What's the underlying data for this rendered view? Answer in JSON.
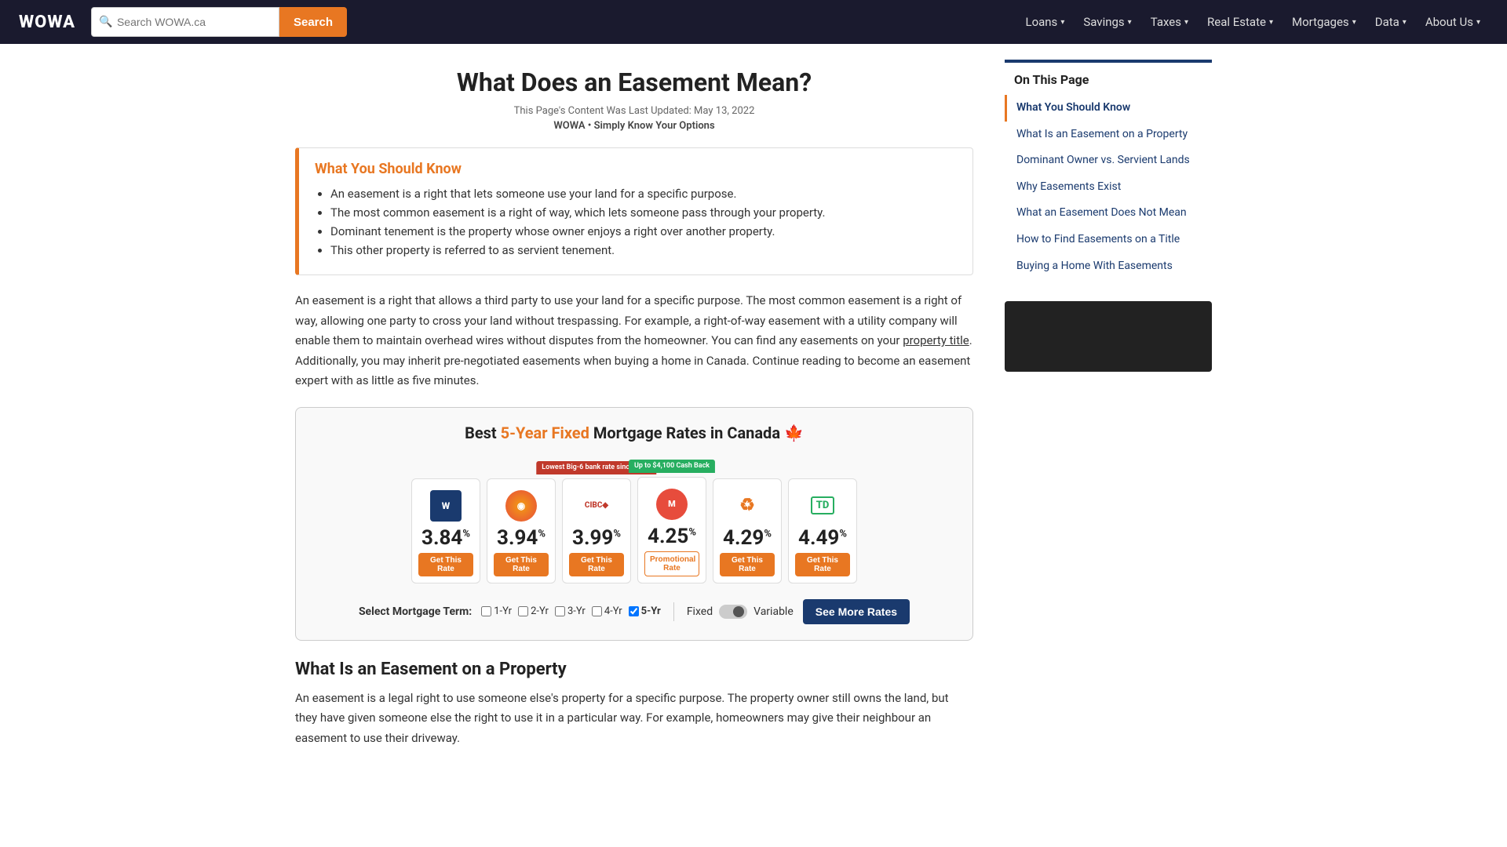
{
  "navbar": {
    "brand": "WOWA",
    "search_placeholder": "Search WOWA.ca",
    "search_btn": "Search",
    "nav_items": [
      {
        "label": "Loans",
        "has_dropdown": true
      },
      {
        "label": "Savings",
        "has_dropdown": true
      },
      {
        "label": "Taxes",
        "has_dropdown": true
      },
      {
        "label": "Real Estate",
        "has_dropdown": true
      },
      {
        "label": "Mortgages",
        "has_dropdown": true
      },
      {
        "label": "Data",
        "has_dropdown": true
      },
      {
        "label": "About Us",
        "has_dropdown": true
      }
    ]
  },
  "article": {
    "title": "What Does an Easement Mean?",
    "meta": "This Page's Content Was Last Updated: May 13, 2022",
    "tagline": "WOWA • Simply Know Your Options",
    "info_box": {
      "title": "What You Should Know",
      "bullets": [
        "An easement is a right that lets someone use your land for a specific purpose.",
        "The most common easement is a right of way, which lets someone pass through your property.",
        "Dominant tenement is the property whose owner enjoys a right over another property.",
        "This other property is referred to as servient tenement."
      ]
    },
    "body_intro": "An easement is a right that allows a third party to use your land for a specific purpose. The most common easement is a right of way, allowing one party to cross your land without trespassing. For example, a right-of-way easement with a utility company will enable them to maintain overhead wires without disputes from the homeowner. You can find any easements on your property title. Additionally, you may inherit pre-negotiated easements when buying a home in Canada. Continue reading to become an easement expert with as little as five minutes.",
    "body_link_text": "property title",
    "section_title": "What Is an Easement on a Property",
    "section_body": "An easement is a legal right to use someone else's property for a specific purpose. The property owner still owns the land, but they have given someone else the right to use it in a particular way. For example, homeowners may give their neighbour an easement to use their driveway."
  },
  "rates": {
    "title_start": "Best ",
    "title_highlight": "5-Year Fixed",
    "title_end": " Mortgage Rates in Canada ",
    "flag": "🍁",
    "cards": [
      {
        "logo_type": "wowa",
        "logo_text": "W",
        "rate": "3.84",
        "sup": "%",
        "btn_label": "Get This Rate",
        "btn_type": "normal",
        "badge": null
      },
      {
        "logo_type": "circle",
        "logo_text": "O",
        "rate": "3.94",
        "sup": "%",
        "btn_label": "Get This Rate",
        "btn_type": "normal",
        "badge": null
      },
      {
        "logo_type": "cibc",
        "logo_text": "CIBC◆",
        "rate": "3.99",
        "sup": "%",
        "btn_label": "Get This Rate",
        "btn_type": "normal",
        "badge": {
          "text": "Lowest Big-6 bank rate since 2022",
          "color": "red"
        }
      },
      {
        "logo_type": "mogo",
        "logo_text": "M",
        "rate": "4.25",
        "sup": "%",
        "btn_label": "Promotional Rate",
        "btn_type": "promo",
        "badge": {
          "text": "Up to $4,100 Cash Back",
          "color": "green"
        }
      },
      {
        "logo_type": "cf",
        "logo_text": "♻",
        "rate": "4.29",
        "sup": "%",
        "btn_label": "Get This Rate",
        "btn_type": "normal",
        "badge": null
      },
      {
        "logo_type": "td",
        "logo_text": "TD",
        "rate": "4.49",
        "sup": "%",
        "btn_label": "Get This Rate",
        "btn_type": "normal",
        "badge": null
      }
    ],
    "term_label": "Select Mortgage Term:",
    "terms": [
      {
        "label": "1-Yr",
        "checked": false
      },
      {
        "label": "2-Yr",
        "checked": false
      },
      {
        "label": "3-Yr",
        "checked": false
      },
      {
        "label": "4-Yr",
        "checked": false
      },
      {
        "label": "5-Yr",
        "checked": true
      }
    ],
    "fixed_label": "Fixed",
    "variable_label": "Variable",
    "see_more_btn": "See More Rates"
  },
  "toc": {
    "title": "On This Page",
    "items": [
      {
        "label": "What You Should Know",
        "active": true
      },
      {
        "label": "What Is an Easement on a Property",
        "active": false
      },
      {
        "label": "Dominant Owner vs. Servient Lands",
        "active": false
      },
      {
        "label": "Why Easements Exist",
        "active": false
      },
      {
        "label": "What an Easement Does Not Mean",
        "active": false
      },
      {
        "label": "How to Find Easements on a Title",
        "active": false
      },
      {
        "label": "Buying a Home With Easements",
        "active": false
      }
    ]
  }
}
